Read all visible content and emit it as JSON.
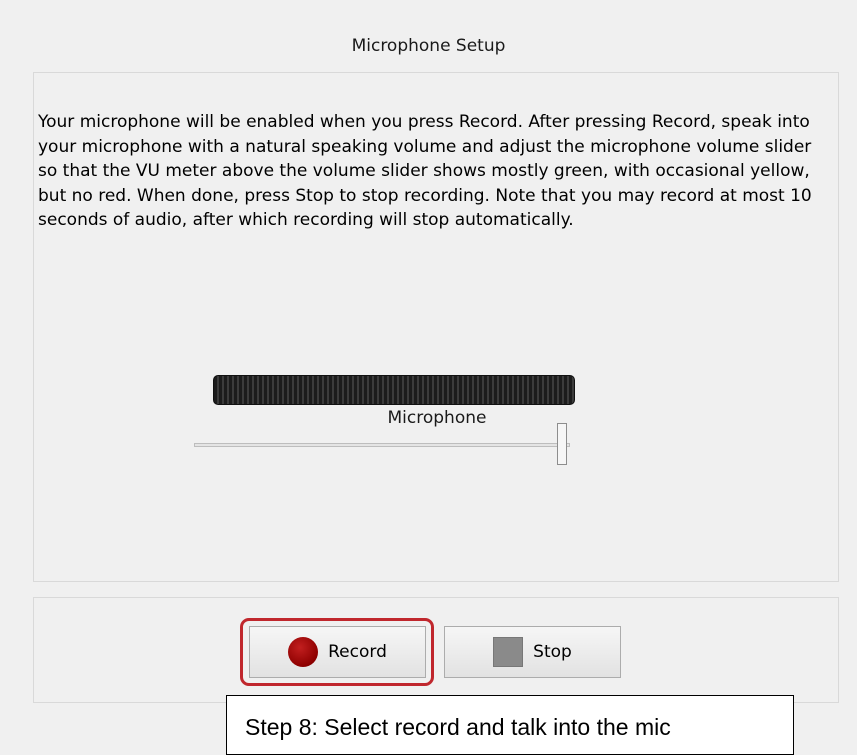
{
  "dialog": {
    "title": "Microphone Setup",
    "instructions": "Your microphone will be enabled when you press Record. After pressing Record, speak into your microphone with a natural speaking volume and adjust the microphone volume slider so that the VU meter above the volume slider shows mostly green, with occasional yellow, but no red. When done, press Stop to stop recording. Note that you may record at most 10 seconds of audio, after which recording will stop automatically.",
    "microphone_label": "Microphone",
    "volume_slider_value_percent": 100
  },
  "buttons": {
    "record_label": "Record",
    "stop_label": "Stop",
    "record_icon": "record-icon",
    "stop_icon": "stop-icon"
  },
  "annotation": {
    "callout_text": "Step 8: Select record and talk into the mic",
    "highlight_color": "#c0272d"
  },
  "colors": {
    "record_red": "#8e0000",
    "stop_gray": "#8a8a8a"
  }
}
